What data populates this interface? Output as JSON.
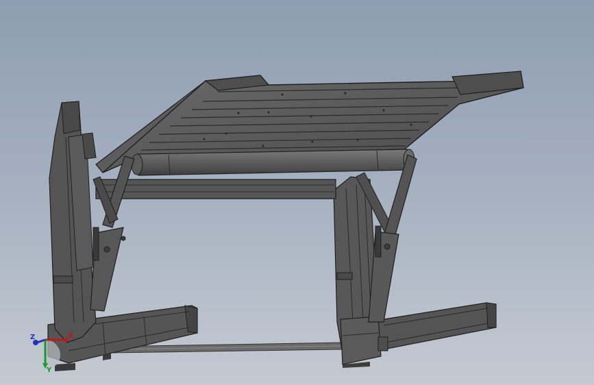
{
  "viewport": {
    "background_top": "#8e9db1",
    "background_bottom": "#c4cad2",
    "model_color": "#545454",
    "edge_color": "#1f1f1f"
  },
  "triad": {
    "x_label": "X",
    "y_label": "Y",
    "z_label": "Z",
    "x_color": "#c0171b",
    "y_color": "#1a9a27",
    "z_color": "#2433b8"
  }
}
